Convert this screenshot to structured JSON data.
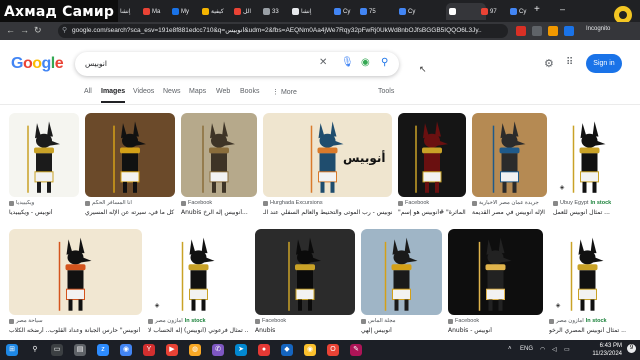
{
  "overlay_title": "Ахмад Самир",
  "browser": {
    "tabs": [
      {
        "label": "إنشا",
        "color": "#e8eaed"
      },
      {
        "label": "Ma",
        "color": "#ea4335"
      },
      {
        "label": "My",
        "color": "#1a73e8"
      },
      {
        "label": "كيفية",
        "color": "#f4b400"
      },
      {
        "label": "الل",
        "color": "#ea4335"
      },
      {
        "label": "33",
        "color": "#9aa0a6"
      },
      {
        "label": "إنشا",
        "color": "#e8eaed"
      },
      {
        "label": "Cy",
        "color": "#4285f4"
      },
      {
        "label": "75",
        "color": "#4285f4"
      },
      {
        "label": "Cy",
        "color": "#4285f4"
      },
      {
        "label": "",
        "color": "#ffffff"
      },
      {
        "label": "97",
        "color": "#ea4335"
      },
      {
        "label": "Cy",
        "color": "#4285f4"
      }
    ],
    "new_tab": "+",
    "window_controls": [
      "–",
      "▢",
      "✕"
    ],
    "url": "google.com/search?sca_esv=191e8f881edcc710&q=انوبيس&udm=2&fbs=AEQNm0Aa4jWe7Rqy32pFwRj0UkWd8nbOJfsBGGB5IQQO6L3Jy..",
    "incognito_label": "Incognito"
  },
  "google": {
    "logo_letters": [
      "G",
      "o",
      "o",
      "g",
      "l",
      "e"
    ],
    "query": "انوبيس",
    "sign_in": "Sign in",
    "tabs": [
      {
        "label": "All",
        "active": false
      },
      {
        "label": "Images",
        "active": true
      },
      {
        "label": "Videos",
        "active": false
      },
      {
        "label": "News",
        "active": false
      },
      {
        "label": "Maps",
        "active": false
      },
      {
        "label": "Web",
        "active": false
      },
      {
        "label": "Books",
        "active": false
      },
      {
        "label": "⋮ More",
        "active": false
      }
    ],
    "tools": "Tools"
  },
  "results_row1": [
    {
      "source": "ويكيبيديا",
      "caption": "أنوبيس - ويكيبيديا",
      "stock": ""
    },
    {
      "source": "أنا المسافر الحكم",
      "caption": "كل ما في، سيرته عن الإله المسيري ...",
      "stock": ""
    },
    {
      "source": "Facebook",
      "caption": "Anubis أنوبيس إله الرخ...",
      "stock": ""
    },
    {
      "source": "Hurghada Excursions",
      "caption": "أنوبيس - رب الموتى والتحنيط والعالم السفلي عند الـ...",
      "stock": ""
    },
    {
      "source": "Facebook",
      "caption": "\"الماثرة\" #أنوبيس هو إسم...",
      "stock": ""
    },
    {
      "source": "جريدة عمان مصر الاخبارية",
      "caption": "الإله أنوبيس في مصر القديمة",
      "stock": ""
    },
    {
      "source": "Ubuy Egypt",
      "caption": "تمثال أنوبيس للعمل ...",
      "stock": "In stock"
    }
  ],
  "results_row2": [
    {
      "source": "سياحة مصر",
      "caption": "أنوبيس\" حارس الجبانة وعداد القلوب.. أرضخه الكلاب",
      "stock": ""
    },
    {
      "source": "أمازون مصر",
      "caption": "تمثال فرعوني (أنوبيس) إله الحساب لا ...",
      "stock": "In stock"
    },
    {
      "source": "Facebook",
      "caption": "Anubis",
      "stock": ""
    },
    {
      "source": "مجلة الماس",
      "caption": "أنوبيس إلهي",
      "stock": ""
    },
    {
      "source": "Facebook",
      "caption": "Anubis - أنوبيس",
      "stock": ""
    },
    {
      "source": "أمازون مصر",
      "caption": "تمثال أنوبيس المصري الرخو ...",
      "stock": "In stock"
    }
  ],
  "tile_text": "أنوبيس",
  "taskbar": {
    "time": "6:43 PM",
    "date": "11/23/2024",
    "lang": "ENG",
    "notif": "9"
  },
  "colors": {
    "google_blue": "#1a73e8",
    "stock_green": "#188038",
    "chrome_dark": "#202124"
  }
}
